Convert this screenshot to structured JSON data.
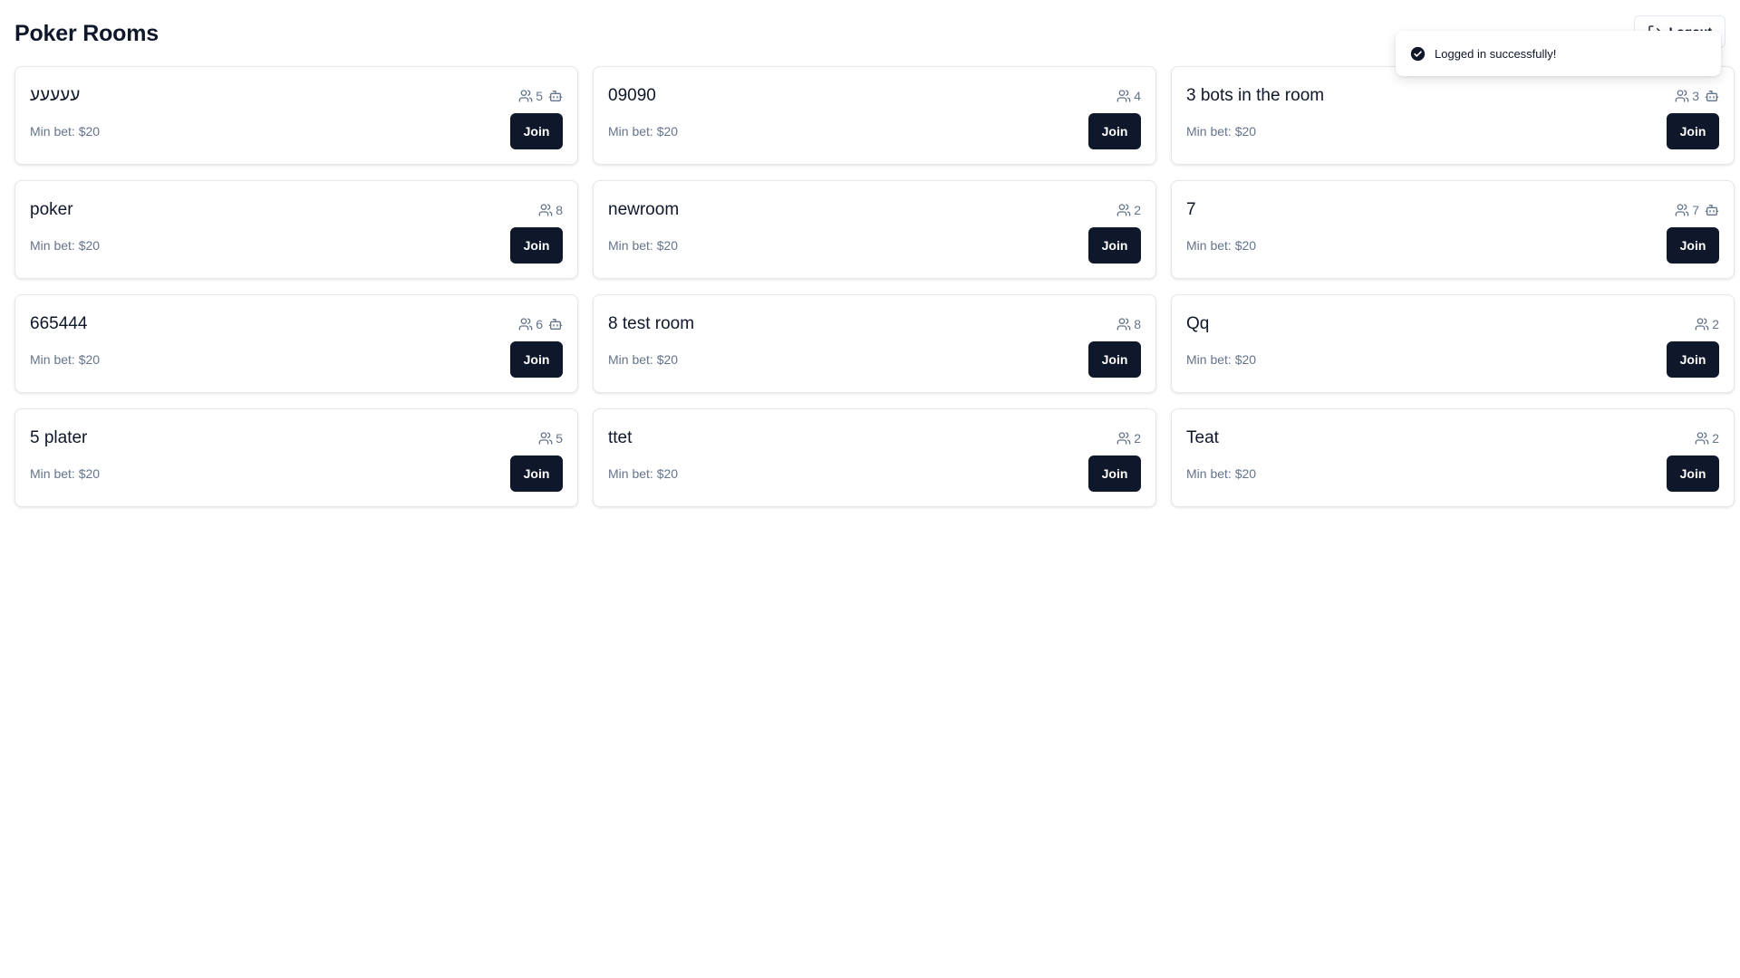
{
  "header": {
    "title": "Poker Rooms",
    "logout_label": "Logout"
  },
  "toast": {
    "message": "Logged in successfully!",
    "icon": "check-circle-icon"
  },
  "rooms": [
    {
      "name": "עעעעע",
      "players": "5",
      "has_bots": true,
      "min_bet": "Min bet: $20",
      "join_label": "Join"
    },
    {
      "name": "09090",
      "players": "4",
      "has_bots": false,
      "min_bet": "Min bet: $20",
      "join_label": "Join"
    },
    {
      "name": "3 bots in the room",
      "players": "3",
      "has_bots": true,
      "min_bet": "Min bet: $20",
      "join_label": "Join"
    },
    {
      "name": "poker",
      "players": "8",
      "has_bots": false,
      "min_bet": "Min bet: $20",
      "join_label": "Join"
    },
    {
      "name": "newroom",
      "players": "2",
      "has_bots": false,
      "min_bet": "Min bet: $20",
      "join_label": "Join"
    },
    {
      "name": "7",
      "players": "7",
      "has_bots": true,
      "min_bet": "Min bet: $20",
      "join_label": "Join"
    },
    {
      "name": "665444",
      "players": "6",
      "has_bots": true,
      "min_bet": "Min bet: $20",
      "join_label": "Join"
    },
    {
      "name": "8 test room",
      "players": "8",
      "has_bots": false,
      "min_bet": "Min bet: $20",
      "join_label": "Join"
    },
    {
      "name": "Qq",
      "players": "2",
      "has_bots": false,
      "min_bet": "Min bet: $20",
      "join_label": "Join"
    },
    {
      "name": "5 plater",
      "players": "5",
      "has_bots": false,
      "min_bet": "Min bet: $20",
      "join_label": "Join"
    },
    {
      "name": "ttet",
      "players": "2",
      "has_bots": false,
      "min_bet": "Min bet: $20",
      "join_label": "Join"
    },
    {
      "name": "Teat",
      "players": "2",
      "has_bots": false,
      "min_bet": "Min bet: $20",
      "join_label": "Join"
    }
  ],
  "colors": {
    "primary": "#0f172a",
    "muted_text": "#64748b",
    "border": "#e5e7eb"
  }
}
